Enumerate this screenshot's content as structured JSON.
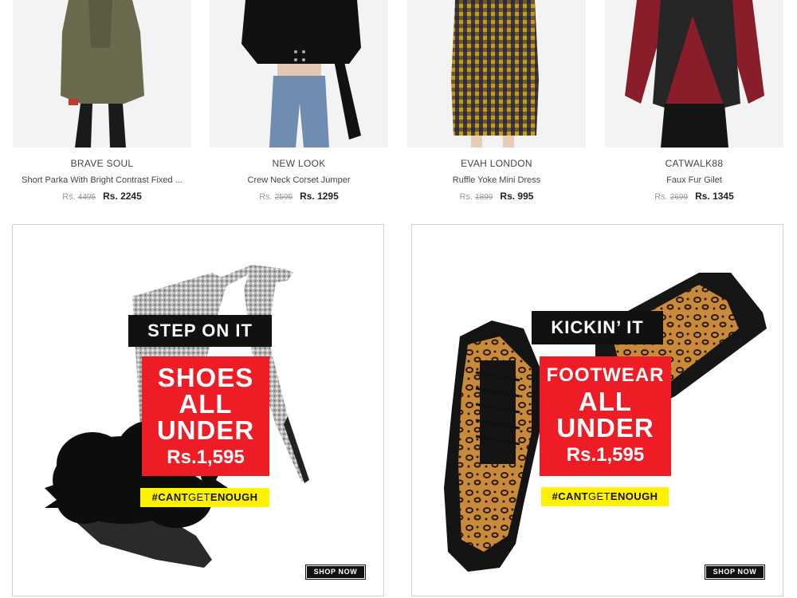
{
  "products": [
    {
      "brand": "BRAVE SOUL",
      "name": "Short Parka With Bright Contrast Fixed ...",
      "currency": "Rs.",
      "old_price": "4495",
      "new_price": "Rs. 2245"
    },
    {
      "brand": "NEW LOOK",
      "name": "Crew Neck Corset Jumper",
      "currency": "Rs.",
      "old_price": "2595",
      "new_price": "Rs. 1295"
    },
    {
      "brand": "EVAH LONDON",
      "name": "Ruffle Yoke Mini Dress",
      "currency": "Rs.",
      "old_price": "1899",
      "new_price": "Rs. 995"
    },
    {
      "brand": "CATWALK88",
      "name": "Faux Fur Gilet",
      "currency": "Rs.",
      "old_price": "2699",
      "new_price": "Rs. 1345"
    }
  ],
  "banners": [
    {
      "tag": "STEP ON IT",
      "line1": "SHOES",
      "line2": "ALL",
      "line3": "UNDER",
      "price": "Rs.1,595",
      "hashtag_bold1": "#CANT",
      "hashtag_thin": "GET",
      "hashtag_bold2": "ENOUGH",
      "cta": "SHOP NOW"
    },
    {
      "tag": "KICKIN’ IT",
      "line1": "FOOTWEAR",
      "line2": "ALL",
      "line3": "UNDER",
      "price": "Rs.1,595",
      "hashtag_bold1": "#CANT",
      "hashtag_thin": "GET",
      "hashtag_bold2": "ENOUGH",
      "cta": "SHOP NOW"
    }
  ],
  "colors": {
    "banner_red": "#ee1c25",
    "hashtag_yellow": "#fff200",
    "tag_black": "#111111"
  }
}
